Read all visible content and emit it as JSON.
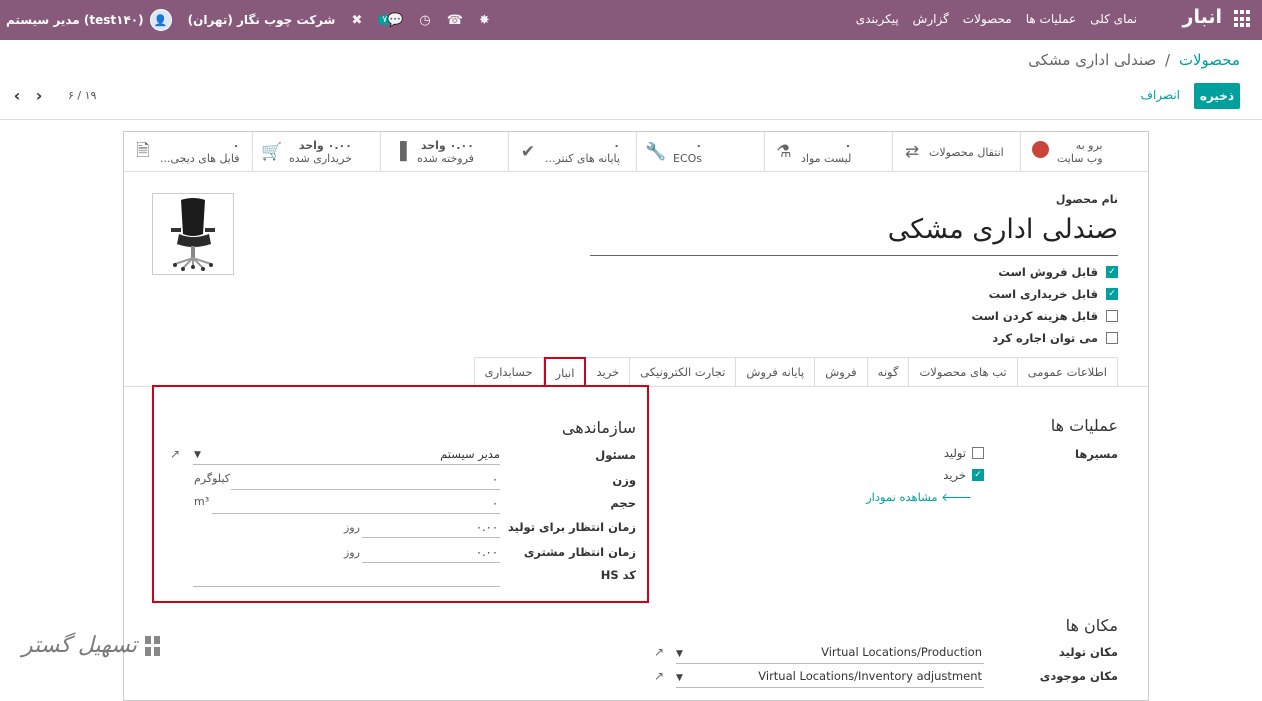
{
  "topbar": {
    "brand": "انبار",
    "menu": [
      "نمای کلی",
      "عملیات ها",
      "محصولات",
      "گزارش",
      "پیکربندی"
    ],
    "user": "مدیر سیستم (test۱۴۰)",
    "company": "شرکت چوب نگار (تهران)",
    "messages_count": "۷"
  },
  "breadcrumb": {
    "parent": "محصولات",
    "separator": "/",
    "current": "صندلی اداری مشکی"
  },
  "actions": {
    "save": "ذخیره",
    "discard": "انصراف"
  },
  "pager": {
    "count": "۶ / ۱۹"
  },
  "smart_buttons": [
    {
      "icon": "globe-icon",
      "line1": "برو به",
      "line2": "وب سایت"
    },
    {
      "icon": "transfer-icon",
      "line1": "",
      "line2": "انتقال محصولات"
    },
    {
      "icon": "flask-icon",
      "line1": "۰",
      "line2": "لیست مواد"
    },
    {
      "icon": "wrench-icon",
      "line1": "۰",
      "line2": "ECOs"
    },
    {
      "icon": "check-icon",
      "line1": "۰",
      "line2": "پایانه های کنتر..."
    },
    {
      "icon": "bar-chart-icon",
      "line1": "۰.۰۰ واحد",
      "line2": "فروخته شده"
    },
    {
      "icon": "cart-icon",
      "line1": "۰.۰۰ واحد",
      "line2": "خریداری شده"
    },
    {
      "icon": "file-icon",
      "line1": "۰",
      "line2": "فایل های دیجی..."
    }
  ],
  "product": {
    "name_label": "نام محصول",
    "name": "صندلی اداری مشکی",
    "flags": [
      {
        "label": "قابل فروش است",
        "checked": true
      },
      {
        "label": "قابل خریداری است",
        "checked": true
      },
      {
        "label": "قابل هزینه کردن است",
        "checked": false
      },
      {
        "label": "می توان اجاره کرد",
        "checked": false
      }
    ]
  },
  "tabs": [
    "اطلاعات عمومی",
    "تب های محصولات",
    "گونه",
    "فروش",
    "پایانه فروش",
    "تجارت الکترونیکی",
    "خرید",
    "انبار",
    "حسابداری"
  ],
  "active_tab": "انبار",
  "operations": {
    "title": "عملیات ها",
    "routes_label": "مسیرها",
    "routes": [
      {
        "label": "تولید",
        "checked": false
      },
      {
        "label": "خرید",
        "checked": true
      }
    ],
    "view_diagram": "مشاهده نمودار"
  },
  "organization": {
    "title": "سازماندهی",
    "responsible_label": "مسئول",
    "responsible_value": "مدیر سیستم",
    "weight_label": "وزن",
    "weight_value": "۰",
    "weight_unit": "کیلوگرم",
    "volume_label": "حجم",
    "volume_value": "۰",
    "volume_unit": "m³",
    "mfg_lead_label": "زمان انتظار برای تولید",
    "mfg_lead_value": "۰.۰۰",
    "mfg_lead_unit": "روز",
    "customer_lead_label": "زمان انتظار مشتری",
    "customer_lead_value": "۰.۰۰",
    "customer_lead_unit": "روز",
    "hs_label": "کد HS",
    "hs_value": ""
  },
  "locations": {
    "title": "مکان ها",
    "production_label": "مکان تولید",
    "production_value": "Virtual Locations/Production",
    "inventory_label": "مکان موجودی",
    "inventory_value": "Virtual Locations/Inventory adjustment"
  },
  "watermark": {
    "text": "تسهیل گستر"
  }
}
